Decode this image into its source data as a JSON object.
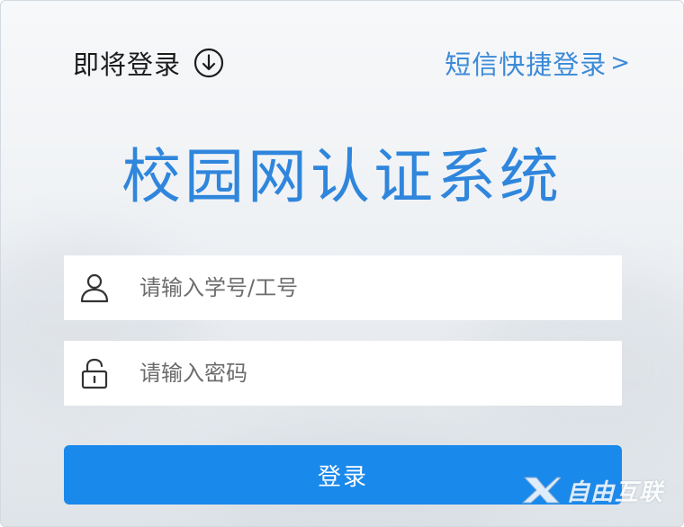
{
  "header": {
    "about_login_label": "即将登录",
    "about_login_icon": "arrow-down-circle-icon",
    "sms_login_label": "短信快捷登录",
    "sms_login_chevron": ">"
  },
  "title": "校园网认证系统",
  "form": {
    "username": {
      "icon": "user-icon",
      "placeholder": "请输入学号/工号",
      "value": ""
    },
    "password": {
      "icon": "lock-icon",
      "placeholder": "请输入密码",
      "value": ""
    },
    "submit_label": "登录"
  },
  "watermark": {
    "logo_icon": "x-logo-icon",
    "text": "自由互联"
  },
  "colors": {
    "accent": "#1a89ec",
    "link": "#3b8ad8",
    "title": "#2f86dc"
  }
}
